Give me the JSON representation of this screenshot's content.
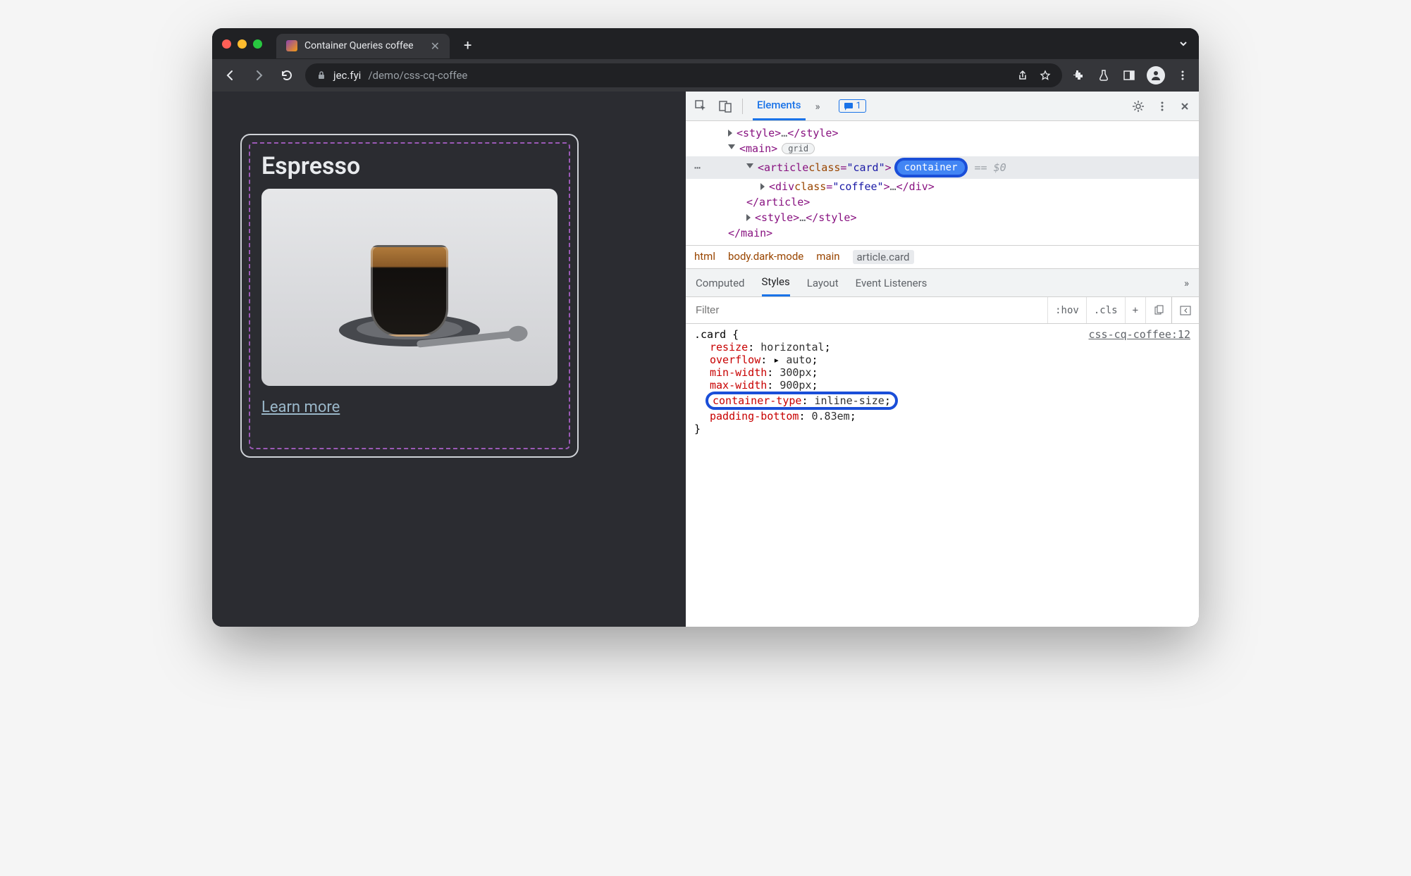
{
  "titlebar": {
    "tab_title": "Container Queries coffee"
  },
  "address": {
    "host": "jec.fyi",
    "path": "/demo/css-cq-coffee"
  },
  "page": {
    "card_title": "Espresso",
    "learn_more": "Learn more"
  },
  "devtools": {
    "top": {
      "elements_tab": "Elements",
      "message_count": "1"
    },
    "dom": {
      "style_open": "<style>",
      "style_dots": "…",
      "style_close": "</style>",
      "main_open": "<main>",
      "main_badge": "grid",
      "article_open_1": "<article ",
      "article_attr": "class",
      "article_val": "\"card\"",
      "article_open_2": ">",
      "container_badge": "container",
      "dollar": "== $0",
      "div_open_1": "<div ",
      "div_attr": "class",
      "div_val": "\"coffee\"",
      "div_open_2": ">",
      "div_dots": "…",
      "div_close": "</div>",
      "article_close": "</article>",
      "style2_open": "<style>",
      "style2_dots": "…",
      "style2_close": "</style>",
      "main_close": "</main>"
    },
    "breadcrumb": {
      "b1": "html",
      "b2": "body.dark-mode",
      "b3": "main",
      "b4": "article.card"
    },
    "subpanels": {
      "computed": "Computed",
      "styles": "Styles",
      "layout": "Layout",
      "listeners": "Event Listeners"
    },
    "filter": {
      "placeholder": "Filter",
      "hov": ":hov",
      "cls": ".cls"
    },
    "styles": {
      "selector": ".card {",
      "source": "css-cq-coffee:12",
      "p1n": "resize",
      "p1v": "horizontal",
      "p2n": "overflow",
      "p2v": "auto",
      "p3n": "min-width",
      "p3v": "300px",
      "p4n": "max-width",
      "p4v": "900px",
      "p5n": "container-type",
      "p5v": "inline-size",
      "p6n": "padding-bottom",
      "p6v": "0.83em",
      "close": "}"
    }
  }
}
